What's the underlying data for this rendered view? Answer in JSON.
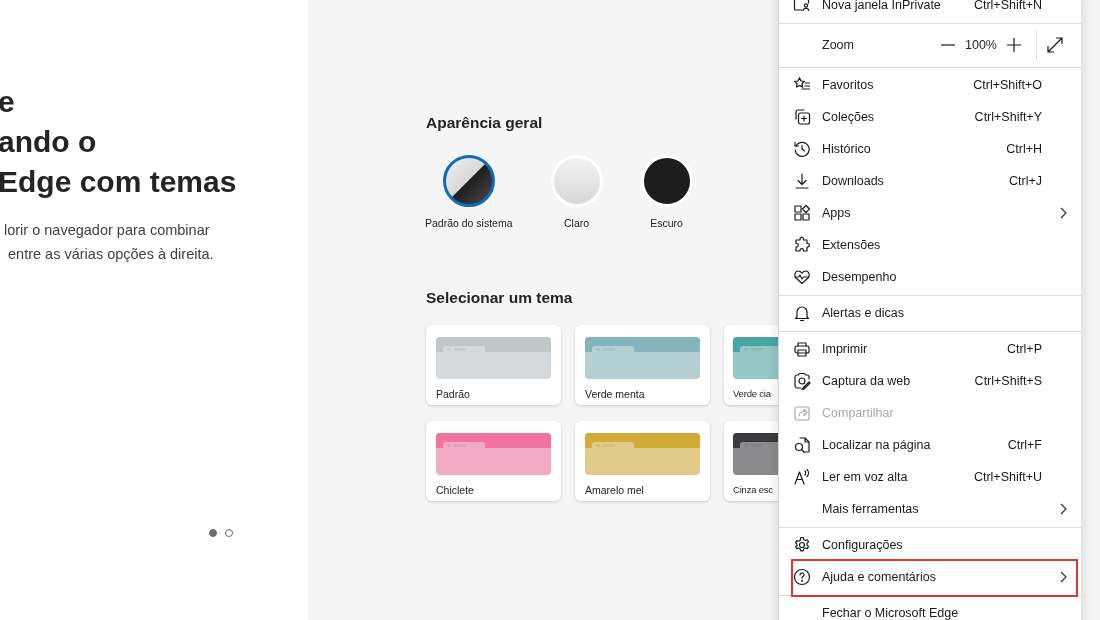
{
  "intro": {
    "heading_lines": [
      "e",
      "ando o",
      "Edge com temas"
    ],
    "text_lines": [
      "lorir o navegador para combinar",
      " entre as várias opções à direita."
    ],
    "pages": [
      {
        "selected": true
      },
      {
        "selected": false
      }
    ]
  },
  "appearance": {
    "title": "Aparência geral",
    "options": [
      {
        "label": "Padrão do sistema",
        "kind": "system",
        "selected": true
      },
      {
        "label": "Claro",
        "kind": "light",
        "selected": false
      },
      {
        "label": "Escuro",
        "kind": "dark",
        "selected": false
      }
    ]
  },
  "themes": {
    "title": "Selecionar um tema",
    "items": [
      {
        "label": "Padrão",
        "color": "#c1c6c9",
        "selected": false
      },
      {
        "label": "Verde menta",
        "color": "#85b5bc",
        "selected": false
      },
      {
        "label": "Verde cia",
        "color": "#4aa6a6",
        "selected": false
      },
      {
        "label": "Chiclete",
        "color": "#f272a0",
        "selected": false
      },
      {
        "label": "Amarelo mel",
        "color": "#d4ab37",
        "selected": false
      },
      {
        "label": "Cinza esc",
        "color": "#3b3b3d",
        "selected": false
      }
    ]
  },
  "menu": {
    "sections": [
      [
        {
          "kind": "item",
          "label": "Nova janela InPrivate",
          "shortcut": "Ctrl+Shift+N",
          "submenu": false,
          "disabled": false,
          "highlighted": false
        }
      ],
      [
        {
          "kind": "zoom",
          "label": "Zoom",
          "value": "100%"
        }
      ],
      [
        {
          "kind": "item",
          "label": "Favoritos",
          "shortcut": "Ctrl+Shift+O",
          "submenu": false,
          "disabled": false,
          "highlighted": false
        },
        {
          "kind": "item",
          "label": "Coleções",
          "shortcut": "Ctrl+Shift+Y",
          "submenu": false,
          "disabled": false,
          "highlighted": false
        },
        {
          "kind": "item",
          "label": "Histórico",
          "shortcut": "Ctrl+H",
          "submenu": false,
          "disabled": false,
          "highlighted": false
        },
        {
          "kind": "item",
          "label": "Downloads",
          "shortcut": "Ctrl+J",
          "submenu": false,
          "disabled": false,
          "highlighted": false
        },
        {
          "kind": "item",
          "label": "Apps",
          "submenu": true,
          "disabled": false,
          "highlighted": false
        },
        {
          "kind": "item",
          "label": "Extensões",
          "submenu": false,
          "disabled": false,
          "highlighted": false
        },
        {
          "kind": "item",
          "label": "Desempenho",
          "submenu": false,
          "disabled": false,
          "highlighted": false
        }
      ],
      [
        {
          "kind": "item",
          "label": "Alertas e dicas",
          "submenu": false,
          "disabled": false,
          "highlighted": false
        }
      ],
      [
        {
          "kind": "item",
          "label": "Imprimir",
          "shortcut": "Ctrl+P",
          "submenu": false,
          "disabled": false,
          "highlighted": false
        },
        {
          "kind": "item",
          "label": "Captura da web",
          "shortcut": "Ctrl+Shift+S",
          "submenu": false,
          "disabled": false,
          "highlighted": false
        },
        {
          "kind": "item",
          "label": "Compartilhar",
          "submenu": false,
          "disabled": true,
          "highlighted": false
        },
        {
          "kind": "item",
          "label": "Localizar na página",
          "shortcut": "Ctrl+F",
          "submenu": false,
          "disabled": false,
          "highlighted": false
        },
        {
          "kind": "item",
          "label": "Ler em voz alta",
          "shortcut": "Ctrl+Shift+U",
          "submenu": false,
          "disabled": false,
          "highlighted": false
        },
        {
          "kind": "item",
          "label": "Mais ferramentas",
          "submenu": true,
          "disabled": false,
          "highlighted": false
        }
      ],
      [
        {
          "kind": "item",
          "label": "Configurações",
          "submenu": false,
          "disabled": false,
          "highlighted": false
        },
        {
          "kind": "item",
          "label": "Ajuda e comentários",
          "submenu": true,
          "disabled": false,
          "highlighted": true
        }
      ],
      [
        {
          "kind": "item",
          "label": "Fechar o Microsoft Edge",
          "submenu": false,
          "disabled": false,
          "highlighted": false
        }
      ]
    ]
  }
}
